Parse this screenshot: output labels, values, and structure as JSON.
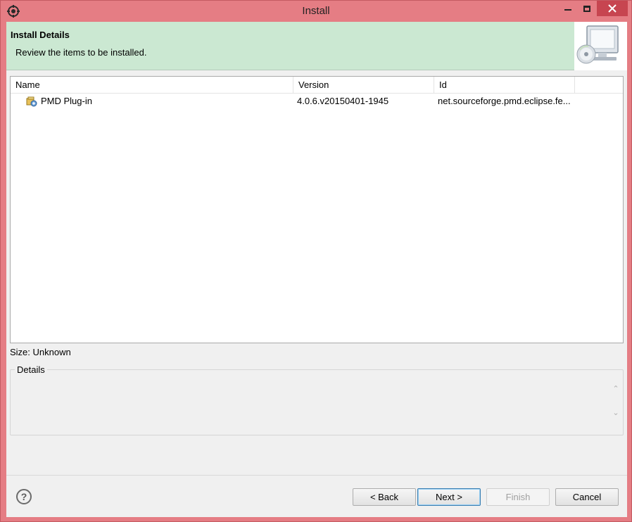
{
  "window": {
    "title": "Install"
  },
  "banner": {
    "title": "Install Details",
    "description": "Review the items to be installed."
  },
  "table": {
    "columns": [
      "Name",
      "Version",
      "Id"
    ],
    "rows": [
      {
        "name": "PMD Plug-in",
        "version": "4.0.6.v20150401-1945",
        "id": "net.sourceforge.pmd.eclipse.fe..."
      }
    ]
  },
  "size_label": "Size: Unknown",
  "details": {
    "legend": "Details",
    "text": ""
  },
  "buttons": {
    "back": "< Back",
    "next": "Next >",
    "finish": "Finish",
    "cancel": "Cancel",
    "help": "?"
  },
  "colors": {
    "titlebar": "#e57d84",
    "banner": "#cbe8d2",
    "close_button": "#c74550"
  }
}
